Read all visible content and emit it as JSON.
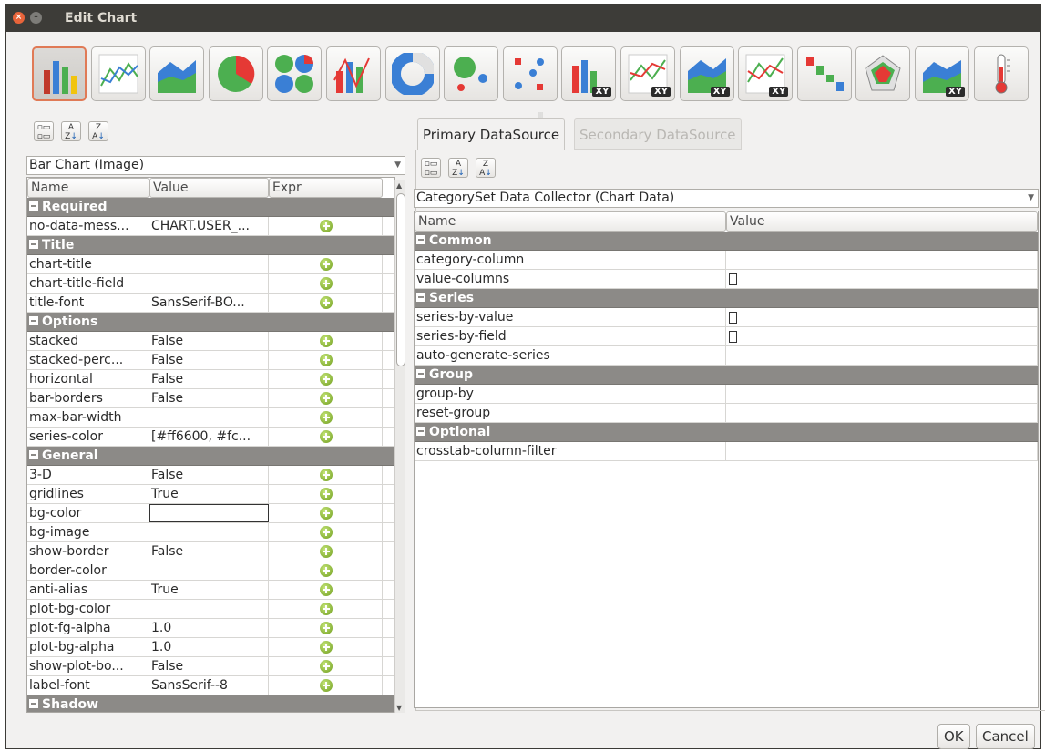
{
  "window": {
    "title": "Edit Chart"
  },
  "chart_types": [
    {
      "name": "bar",
      "xy": ""
    },
    {
      "name": "line",
      "xy": ""
    },
    {
      "name": "area",
      "xy": ""
    },
    {
      "name": "pie",
      "xy": ""
    },
    {
      "name": "multi-pie",
      "xy": ""
    },
    {
      "name": "bar-line",
      "xy": ""
    },
    {
      "name": "ring",
      "xy": ""
    },
    {
      "name": "bubble",
      "xy": ""
    },
    {
      "name": "scatter",
      "xy": ""
    },
    {
      "name": "xy-bar",
      "xy": "XY"
    },
    {
      "name": "xy-line",
      "xy": "XY"
    },
    {
      "name": "xy-area",
      "xy": "XY"
    },
    {
      "name": "extended-xy-line",
      "xy": "XY"
    },
    {
      "name": "waterfall",
      "xy": ""
    },
    {
      "name": "radar",
      "xy": ""
    },
    {
      "name": "xy-area-line",
      "xy": "XY"
    },
    {
      "name": "thermometer",
      "xy": ""
    }
  ],
  "sort_buttons": {
    "categorized": "Categorized",
    "az": "A-Z",
    "za": "Z-A"
  },
  "left": {
    "combo": "Bar Chart (Image)",
    "headers": {
      "name": "Name",
      "value": "Value",
      "expr": "Expr"
    },
    "rows": [
      {
        "type": "cat",
        "name": "Required"
      },
      {
        "name": "no-data-mess...",
        "value": "CHART.USER_...",
        "plus": true
      },
      {
        "type": "cat",
        "name": "Title"
      },
      {
        "name": "chart-title",
        "value": "",
        "plus": true
      },
      {
        "name": "chart-title-field",
        "value": "",
        "plus": true
      },
      {
        "name": "title-font",
        "value": "SansSerif-BO...",
        "plus": true
      },
      {
        "type": "cat",
        "name": "Options"
      },
      {
        "name": "stacked",
        "value": "False",
        "plus": true
      },
      {
        "name": "stacked-perc...",
        "value": "False",
        "plus": true
      },
      {
        "name": "horizontal",
        "value": "False",
        "plus": true
      },
      {
        "name": "bar-borders",
        "value": "False",
        "plus": true
      },
      {
        "name": "max-bar-width",
        "value": "",
        "plus": true
      },
      {
        "name": "series-color",
        "value": "[#ff6600, #fc...",
        "plus": true
      },
      {
        "type": "cat",
        "name": "General"
      },
      {
        "name": "3-D",
        "value": "False",
        "plus": true
      },
      {
        "name": "gridlines",
        "value": "True",
        "plus": true
      },
      {
        "name": "bg-color",
        "value": "",
        "plus": true,
        "editing": true
      },
      {
        "name": "bg-image",
        "value": "",
        "plus": true
      },
      {
        "name": "show-border",
        "value": "False",
        "plus": true
      },
      {
        "name": "border-color",
        "value": "",
        "plus": true
      },
      {
        "name": "anti-alias",
        "value": "True",
        "plus": true
      },
      {
        "name": "plot-bg-color",
        "value": "",
        "plus": true
      },
      {
        "name": "plot-fg-alpha",
        "value": "1.0",
        "plus": true
      },
      {
        "name": "plot-bg-alpha",
        "value": "1.0",
        "plus": true
      },
      {
        "name": "show-plot-bo...",
        "value": "False",
        "plus": true
      },
      {
        "name": "label-font",
        "value": "SansSerif--8",
        "plus": true
      },
      {
        "type": "cat",
        "name": "Shadow"
      }
    ]
  },
  "right": {
    "tabs": {
      "primary": "Primary DataSource",
      "secondary": "Secondary DataSource"
    },
    "combo": "CategorySet Data Collector (Chart Data)",
    "headers": {
      "name": "Name",
      "value": "Value"
    },
    "rows": [
      {
        "type": "cat",
        "name": "Common"
      },
      {
        "name": "category-column",
        "check": false
      },
      {
        "name": "value-columns",
        "check": true
      },
      {
        "type": "cat",
        "name": "Series"
      },
      {
        "name": "series-by-value",
        "check": true
      },
      {
        "name": "series-by-field",
        "check": true
      },
      {
        "name": "auto-generate-series",
        "check": false
      },
      {
        "type": "cat",
        "name": "Group"
      },
      {
        "name": "group-by",
        "check": false
      },
      {
        "name": "reset-group",
        "check": false
      },
      {
        "type": "cat",
        "name": "Optional"
      },
      {
        "name": "crosstab-column-filter",
        "check": false
      }
    ]
  },
  "buttons": {
    "ok": "OK",
    "cancel": "Cancel"
  },
  "colors": {
    "category_row": "#8c8a87",
    "titlebar": "#3d3c38",
    "selected_border": "#e07a56"
  }
}
